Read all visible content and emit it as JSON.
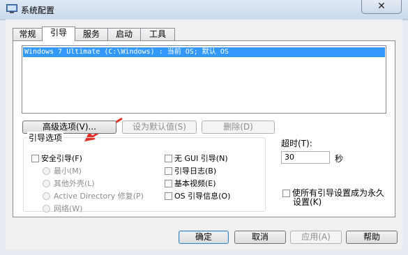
{
  "window": {
    "title": "系统配置",
    "close_glyph": "✕"
  },
  "tabs": [
    {
      "label": "常规",
      "active": false
    },
    {
      "label": "引导",
      "active": true
    },
    {
      "label": "服务",
      "active": false
    },
    {
      "label": "启动",
      "active": false
    },
    {
      "label": "工具",
      "active": false
    }
  ],
  "boot_list": {
    "entries": [
      "Windows 7 Ultimate (C:\\Windows) : 当前 OS; 默认 OS"
    ]
  },
  "actions": {
    "advanced": "高级选项(V)...",
    "set_default": "设为默认值(S)",
    "delete": "删除(D)"
  },
  "boot_options": {
    "title": "引导选项",
    "safe_boot": "安全引导(F)",
    "minimal": "最小(M)",
    "alternate_shell": "其他外壳(L)",
    "ad_repair": "Active Directory 修复(P)",
    "network": "网络(W)",
    "no_gui": "无 GUI 引导(N)",
    "boot_log": "引导日志(B)",
    "base_video": "基本视频(E)",
    "os_boot_info": "OS 引导信息(O)"
  },
  "timeout": {
    "label": "超时(T):",
    "value": "30",
    "unit": "秒"
  },
  "make_permanent": {
    "label_line1": "使所有引导设置成为永久",
    "label_line2": "设置(K)"
  },
  "footer": {
    "ok": "确定",
    "cancel": "取消",
    "apply": "应用(A)",
    "help": "帮助"
  },
  "colors": {
    "selection": "#3399ff",
    "arrow": "#e0302a"
  }
}
